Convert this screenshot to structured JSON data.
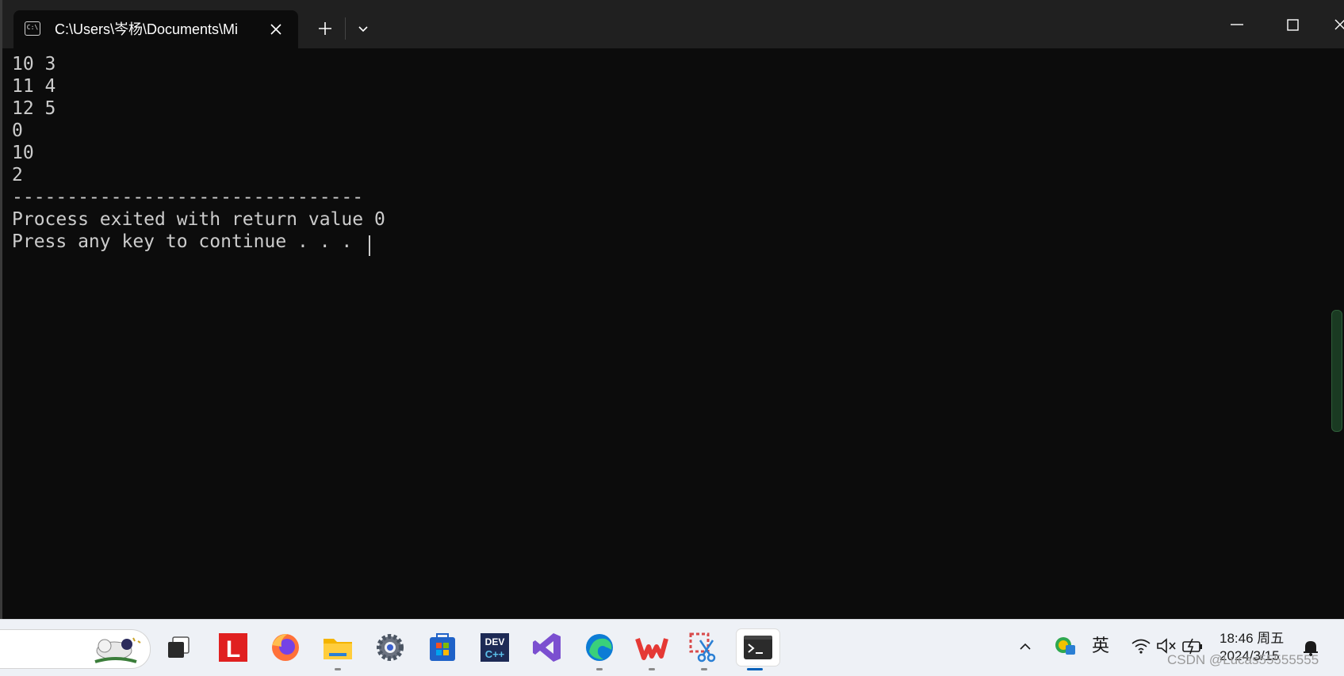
{
  "window": {
    "tab_title": "C:\\Users\\岑杨\\Documents\\Mi",
    "tab_icon_text": "C:\\"
  },
  "console": {
    "lines": [
      "10 3",
      "11 4",
      "12 5",
      "0",
      "10",
      "2",
      "--------------------------------",
      "Process exited with return value 0",
      "Press any key to continue . . . "
    ]
  },
  "taskbar": {
    "apps": [
      {
        "name": "task-view",
        "running": false
      },
      {
        "name": "l-app",
        "label": "L",
        "running": false
      },
      {
        "name": "firefox",
        "running": false
      },
      {
        "name": "file-explorer",
        "running": true
      },
      {
        "name": "settings",
        "running": false
      },
      {
        "name": "microsoft-store",
        "running": false
      },
      {
        "name": "dev-cpp",
        "label": "DEV C++",
        "running": false
      },
      {
        "name": "visual-studio",
        "running": false
      },
      {
        "name": "edge",
        "running": true
      },
      {
        "name": "wps",
        "running": true
      },
      {
        "name": "snipping-tool",
        "running": true
      },
      {
        "name": "terminal",
        "running": true,
        "active": true
      }
    ],
    "tray": {
      "ime": "英",
      "time": "18:46 周五",
      "date": "2024/3/15"
    }
  },
  "watermark": "CSDN @Lucas55555555",
  "colors": {
    "console_bg": "#0c0c0c",
    "console_text": "#cccccc",
    "titlebar_bg": "#202020",
    "taskbar_bg": "#eef1f6",
    "accent": "#005fb8"
  }
}
